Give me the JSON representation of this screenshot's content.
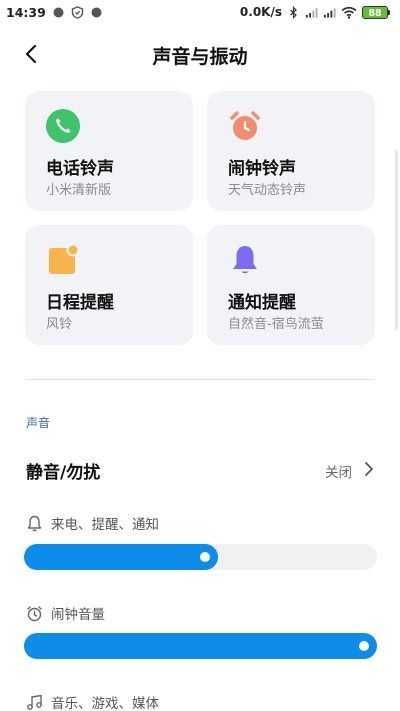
{
  "status_bar": {
    "time": "14:39",
    "network_speed": "0.0K/s",
    "battery": "88"
  },
  "header": {
    "title": "声音与振动"
  },
  "cards": [
    {
      "title": "电话铃声",
      "subtitle": "小米清新版",
      "icon": "phone-icon",
      "color": "#3ec46b"
    },
    {
      "title": "闹钟铃声",
      "subtitle": "天气动态铃声",
      "icon": "alarm-clock-icon",
      "color": "#f38b6f"
    },
    {
      "title": "日程提醒",
      "subtitle": "风铃",
      "icon": "calendar-icon",
      "color": "#f8b44b"
    },
    {
      "title": "通知提醒",
      "subtitle": "自然音-宿鸟流萤",
      "icon": "bell-icon",
      "color": "#7b6cf2"
    }
  ],
  "section": {
    "label": "声音"
  },
  "dnd": {
    "label": "静音/勿扰",
    "value": "关闭"
  },
  "volumes": [
    {
      "label": "来电、提醒、通知",
      "icon": "bell-outline-icon",
      "level": 0.55
    },
    {
      "label": "闹钟音量",
      "icon": "alarm-outline-icon",
      "level": 1.0
    },
    {
      "label": "音乐、游戏、媒体",
      "icon": "music-note-icon",
      "level": null
    }
  ],
  "colors": {
    "accent": "#0d8ce9",
    "card_bg": "#f2f3f6",
    "section_label": "#3a66b5"
  }
}
